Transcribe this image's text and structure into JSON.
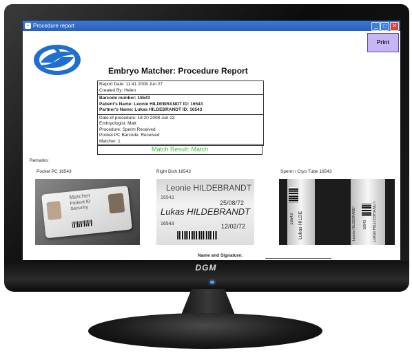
{
  "monitor": {
    "brand": "DGM"
  },
  "window": {
    "title": "Procedure report",
    "minimize": "_",
    "maximize": "□",
    "close": "✕"
  },
  "toolbar": {
    "print_label": "Print"
  },
  "report": {
    "title": "Embryo Matcher: Procedure Report",
    "report_date": "Report Date:  11:41  2008 Jun 27",
    "created_by": "Created By:  Helen",
    "barcode_number": "Barcode number:  16543",
    "patient_name": "Patient's Name:  Leonie HILDEBRANDT  ID:  16543",
    "partner_name": "Partner's Name:  Lukas HILDEBRANDT  ID:  16543",
    "date_of_procedure": "Date of procedure:  18:20  2008 Jun 23",
    "embryologist": "Embryologist:  Matt",
    "procedure": "Procedure:  Sperm Received",
    "pocket_pc_barcode": "Pocket PC Barcode:  Received",
    "matcher": "Matcher:  1",
    "match_result": "Match Result:  Match"
  },
  "remarks_label": "Remarks:",
  "images": [
    {
      "caption": "Pocket PC 16543",
      "card": {
        "brand": "Matcher",
        "line1": "Patient ID",
        "line2": "Security"
      }
    },
    {
      "caption": "Right Dish  16543",
      "dish": {
        "name1": "Leonie HILDEBRANDT",
        "num1": "16543",
        "date1": "25/08/72",
        "name2": "Lukas HILDEBRANDT",
        "num2": "16543",
        "date2": "12/02/72"
      }
    },
    {
      "caption": "Sperm / Cryo Tube 16543",
      "tube": {
        "text1": "Lukas HILDE",
        "text2": "16543",
        "text3": "Leonie HILDEBRANDT",
        "text4": "Lukas HILDEBRANDT",
        "text5": "16543"
      }
    }
  ],
  "signature_label": "Name and Signature:",
  "colors": {
    "match_green": "#3cbd37",
    "print_button": "#c7b6f5",
    "titlebar": "#2a5fbf",
    "logo_blue": "#1f6fd0"
  }
}
